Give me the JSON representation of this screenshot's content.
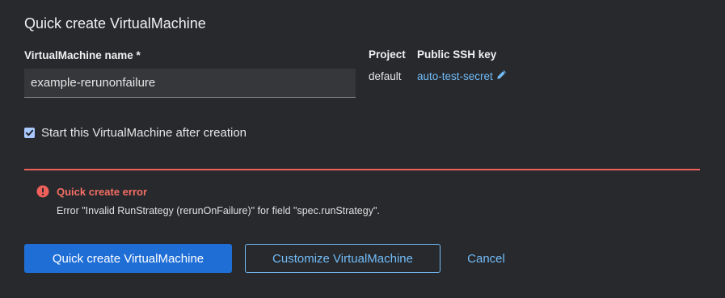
{
  "dialog": {
    "title": "Quick create VirtualMachine"
  },
  "form": {
    "name_label": "VirtualMachine name *",
    "name_value": "example-rerunonfailure",
    "project_label": "Project",
    "project_value": "default",
    "ssh_label": "Public SSH key",
    "ssh_value": "auto-test-secret",
    "ssh_edit_icon": "pencil-icon",
    "start_checkbox_label": "Start this VirtualMachine after creation",
    "start_checked": true
  },
  "alert": {
    "icon": "exclamation-circle-icon",
    "title": "Quick create error",
    "message": "Error \"Invalid RunStrategy (rerunOnFailure)\" for field \"spec.runStrategy\".",
    "color": "#f0605a"
  },
  "actions": {
    "primary_label": "Quick create VirtualMachine",
    "secondary_label": "Customize VirtualMachine",
    "cancel_label": "Cancel"
  },
  "colors": {
    "background": "#27292d",
    "accent": "#73bcf7",
    "primary_button": "#1f6ed6",
    "error": "#f56e64"
  }
}
